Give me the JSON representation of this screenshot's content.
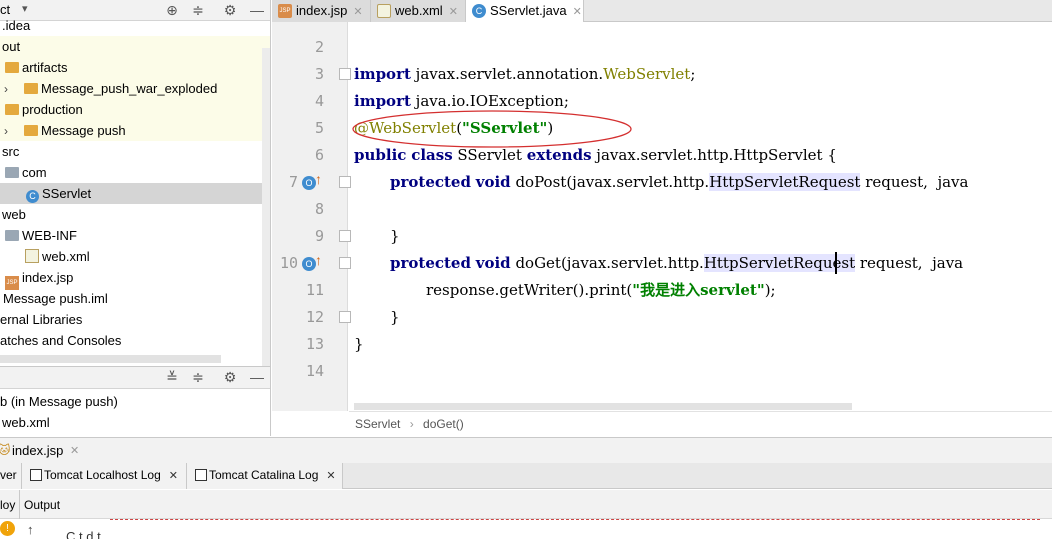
{
  "project_panel": {
    "header_title": "ct",
    "items": [
      {
        "label": ".idea"
      },
      {
        "label": "out"
      },
      {
        "label": "artifacts"
      },
      {
        "label": "Message_push_war_exploded"
      },
      {
        "label": "production"
      },
      {
        "label": "Message push"
      },
      {
        "label": "src"
      },
      {
        "label": "com"
      },
      {
        "label": "SServlet"
      },
      {
        "label": "web"
      },
      {
        "label": "WEB-INF"
      },
      {
        "label": "web.xml"
      },
      {
        "label": "index.jsp"
      },
      {
        "label": "Message push.iml"
      },
      {
        "label": "ernal Libraries"
      },
      {
        "label": "atches and Consoles"
      }
    ]
  },
  "structure_panel": {
    "items": [
      {
        "label": "b (in Message push)"
      },
      {
        "label": "web.xml"
      }
    ]
  },
  "editor_tabs": [
    {
      "label": "index.jsp",
      "active": false
    },
    {
      "label": "web.xml",
      "active": false
    },
    {
      "label": "SServlet.java",
      "active": true
    }
  ],
  "editor": {
    "line_numbers": [
      "2",
      "3",
      "4",
      "5",
      "6",
      "7",
      "8",
      "9",
      "10",
      "11",
      "12",
      "13",
      "14"
    ],
    "lines": {
      "l3": {
        "kw": "import",
        "rest": " javax.servlet.annotation.",
        "ann": "WebServlet",
        "end": ";"
      },
      "l4": {
        "kw": "import",
        "rest": " java.io.IOException;"
      },
      "l5": {
        "at": "@",
        "ann": "WebServlet",
        "open": "(",
        "str": "\"SServlet\"",
        "close": ")"
      },
      "l6": {
        "kw1": "public",
        "kw2": "class",
        "name": " SServlet ",
        "kw3": "extends",
        "rest": " javax.servlet.http.HttpServlet {"
      },
      "l7": {
        "kw1": "protected",
        "kw2": "void",
        "rest1": " doPost(javax.servlet.http.",
        "hl": "HttpServletRequest",
        "rest2": " request,  java"
      },
      "l9": {
        "text": "}"
      },
      "l10": {
        "kw1": "protected",
        "kw2": "void",
        "rest1": " doGet(javax.servlet.http.",
        "hl": "HttpServletRequest",
        "rest2": " request,  java"
      },
      "l11": {
        "rest1": "response.getWriter().print(",
        "str": "\"我是进入servlet\"",
        "rest2": ");"
      },
      "l12": {
        "text": "}"
      },
      "l13": {
        "text": "}"
      }
    }
  },
  "breadcrumb": {
    "items": [
      "SServlet",
      "doGet()"
    ],
    "separator": "›"
  },
  "bottom_file": {
    "label": "index.jsp"
  },
  "services_tabs": [
    {
      "label": "ver"
    },
    {
      "label": "Tomcat Localhost Log"
    },
    {
      "label": "Tomcat Catalina Log"
    }
  ],
  "output": {
    "left_label": "loy",
    "title": "Output",
    "text_fragment": "C  t d  t"
  },
  "colors": {
    "keyword": "#000080",
    "annotation": "#808000",
    "string": "#008000",
    "highlight": "#e4e4ff",
    "circle": "#d42f2f"
  }
}
